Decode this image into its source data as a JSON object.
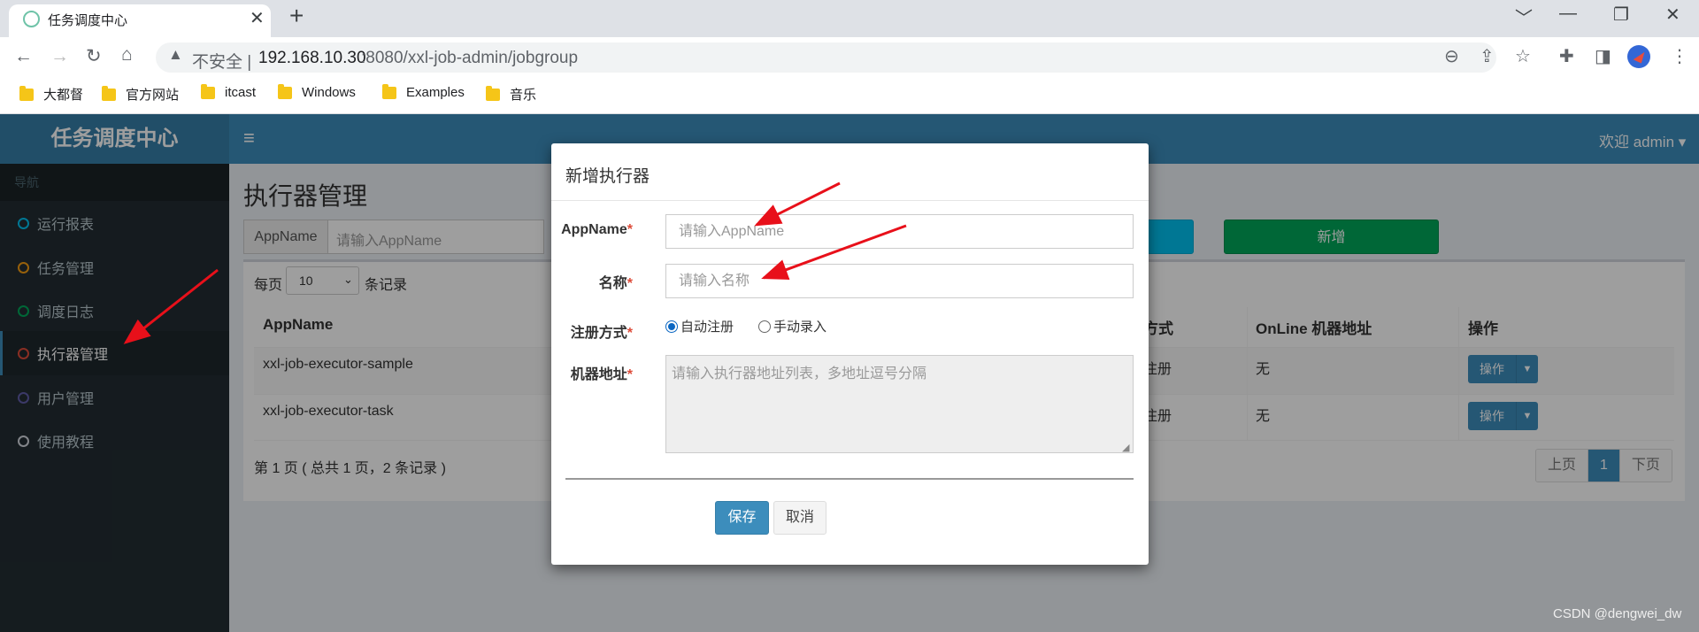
{
  "browser": {
    "tab_title": "任务调度中心",
    "url_insecure": "不安全",
    "url_separator": "|",
    "url_host": "192.168.10.30",
    "url_path": ":8080/xxl-job-admin/jobgroup",
    "bookmarks": [
      "大都督",
      "官方网站",
      "itcast",
      "Windows",
      "Examples",
      "音乐"
    ]
  },
  "app": {
    "logo": "任务调度中心",
    "welcome": "欢迎 admin ▾",
    "sidebar_header": "导航",
    "menu": [
      {
        "label": "运行报表",
        "color": "#00c0ef"
      },
      {
        "label": "任务管理",
        "color": "#f39c12"
      },
      {
        "label": "调度日志",
        "color": "#00a65a"
      },
      {
        "label": "执行器管理",
        "color": "#dd4b39"
      },
      {
        "label": "用户管理",
        "color": "#605ca8"
      },
      {
        "label": "使用教程",
        "color": "#d2d6de"
      }
    ],
    "page_title": "执行器管理",
    "filter": {
      "addon": "AppName",
      "placeholder": "请输入AppName"
    },
    "add_button": "新增",
    "perpage": {
      "before": "每页",
      "value": "10",
      "after": "条记录"
    },
    "table": {
      "headers": [
        "AppName",
        "方式",
        "OnLine 机器地址",
        "操作"
      ],
      "rows": [
        {
          "appname": "xxl-job-executor-sample",
          "type": "注册",
          "online": "无",
          "op": "操作"
        },
        {
          "appname": "xxl-job-executor-task",
          "type": "注册",
          "online": "无",
          "op": "操作"
        }
      ]
    },
    "page_info": "第 1 页 ( 总共 1 页，2 条记录 )",
    "pager": {
      "prev": "上页",
      "current": "1",
      "next": "下页"
    }
  },
  "modal": {
    "title": "新增执行器",
    "fields": {
      "appname_label": "AppName",
      "appname_placeholder": "请输入AppName",
      "name_label": "名称",
      "name_placeholder": "请输入名称",
      "reg_label": "注册方式",
      "reg_auto": "自动注册",
      "reg_manual": "手动录入",
      "addr_label": "机器地址",
      "addr_placeholder": "请输入执行器地址列表，多地址逗号分隔"
    },
    "required_mark": "*",
    "save": "保存",
    "cancel": "取消"
  },
  "watermark": "CSDN @dengwei_dw",
  "colors": {
    "annotation_arrow": "#e8101a",
    "header": "#3c8dbc",
    "sidebar": "#222d32"
  }
}
